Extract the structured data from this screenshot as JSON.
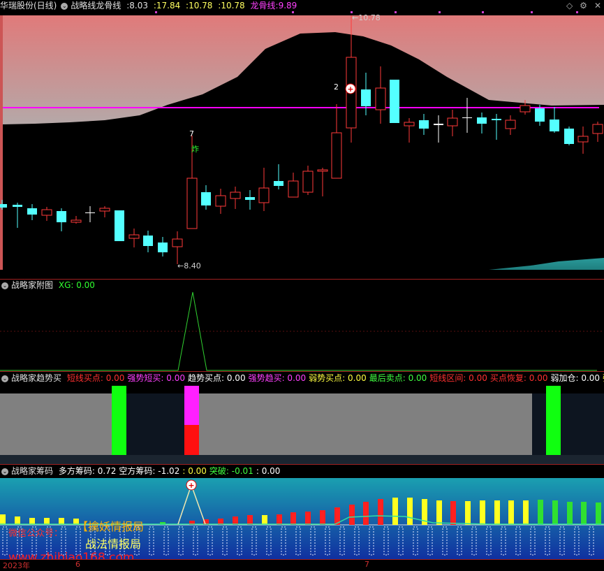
{
  "main_header": {
    "stock_name": "华瑞股份(日线)",
    "indicator_name": "战略线龙骨线",
    "values": [
      ":8.03",
      ":17.84",
      ":10.78",
      ":10.78"
    ],
    "keel_label": "龙骨线:",
    "keel_value": "9.89",
    "icons": [
      "diamond-icon",
      "gear-icon",
      "close-icon"
    ]
  },
  "main_chart": {
    "high_label": "10.78",
    "low_label": "8.40",
    "mark_7": "7",
    "mark_zha": "炸",
    "mark_2": "2"
  },
  "sub1": {
    "title": "战略家附图",
    "xg_label": "XG: 0.00"
  },
  "sub2": {
    "title": "战略家趋势买",
    "items": [
      {
        "label": "短线买点:",
        "value": "0.00",
        "color": "#ff3030"
      },
      {
        "label": "强势短买:",
        "value": "0.00",
        "color": "#ff40ff"
      },
      {
        "label": "趋势买点:",
        "value": "0.00",
        "color": "#ffffff"
      },
      {
        "label": "强势趋买:",
        "value": "0.00",
        "color": "#ff40ff"
      },
      {
        "label": "弱势买点:",
        "value": "0.00",
        "color": "#ffff40"
      },
      {
        "label": "最后卖点:",
        "value": "0.00",
        "color": "#40ff40"
      },
      {
        "label": "短线区间:",
        "value": "0.00",
        "color": "#ff3030"
      },
      {
        "label": "买点恢复:",
        "value": "0.00",
        "color": "#ff3030"
      },
      {
        "label": "弱加仓:",
        "value": "0.00",
        "color": "#ffffff"
      },
      {
        "label": "强加仓:",
        "value": "",
        "color": "#ffff40"
      }
    ]
  },
  "sub3": {
    "title": "战略家筹码",
    "items": [
      {
        "label": "多方筹码:",
        "value": "0.72",
        "color": "#ffffff"
      },
      {
        "label": "空方筹码:",
        "value": "-1.02",
        "color": "#ffffff"
      },
      {
        "label": "",
        "value": ": 0.00",
        "color": "#ffff40"
      },
      {
        "label": "突破:",
        "value": "-0.01",
        "color": "#40ff40"
      },
      {
        "label": "",
        "value": ": 0.00",
        "color": "#ffffff"
      }
    ],
    "watermark_left": "微信公众号：",
    "watermark_line1": "【擒妖情报局",
    "watermark_line2": "战法情报局",
    "watermark_url": "www.zhibiao168.com"
  },
  "axis": {
    "year_label": "2023年",
    "month_6": "6",
    "month_7": "7"
  },
  "colors": {
    "up": "#ff3a3a",
    "down": "#54ffff",
    "keel": "#ff00ff",
    "grey_band": "#808080"
  }
}
